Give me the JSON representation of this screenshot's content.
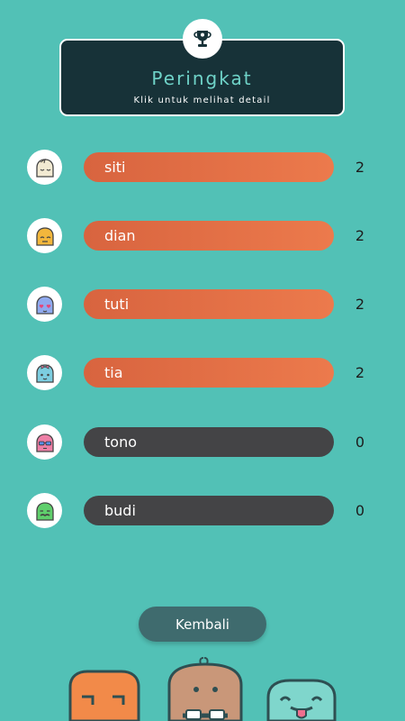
{
  "header": {
    "title": "Peringkat",
    "subtitle": "Klik untuk melihat detail",
    "icon": "trophy-icon"
  },
  "leaderboard": [
    {
      "name": "siti",
      "score": "2",
      "avatar": "sleepy-cream-blob-avatar",
      "status": "active"
    },
    {
      "name": "dian",
      "score": "2",
      "avatar": "yellow-blob-avatar",
      "status": "active"
    },
    {
      "name": "tuti",
      "score": "2",
      "avatar": "heart-eyes-blue-blob-avatar",
      "status": "active"
    },
    {
      "name": "tia",
      "score": "2",
      "avatar": "blue-blob-pink-bow-avatar",
      "status": "active"
    },
    {
      "name": "tono",
      "score": "0",
      "avatar": "pink-blob-sunglasses-avatar",
      "status": "inactive"
    },
    {
      "name": "budi",
      "score": "0",
      "avatar": "green-blob-mustache-avatar",
      "status": "inactive"
    }
  ],
  "back_button": {
    "label": "Kembali"
  },
  "colors": {
    "background": "#52c1b6",
    "header_bg": "#173238",
    "title": "#6fd3c8",
    "active_bar": "#e5703f",
    "inactive_bar": "#444446",
    "button": "#3f6b6e"
  },
  "mascots": [
    "orange-mascot",
    "brown-mascot-glasses",
    "teal-mascot-tongue"
  ]
}
